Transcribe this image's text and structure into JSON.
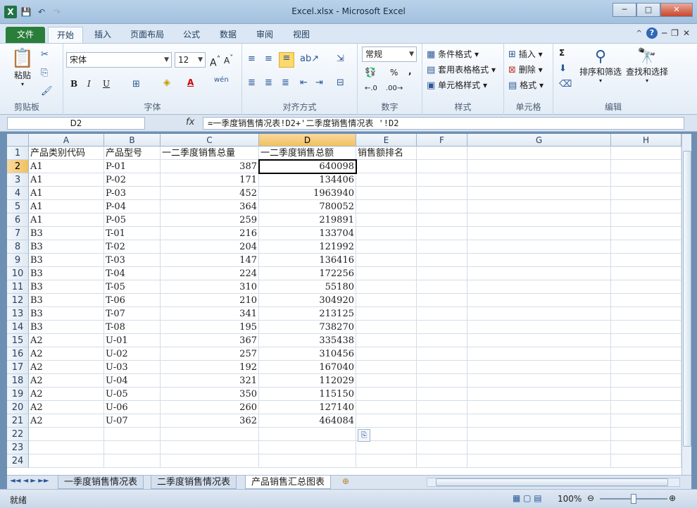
{
  "window": {
    "title": "Excel.xlsx - Microsoft Excel",
    "minimize": "─",
    "maximize": "□",
    "close": "✕"
  },
  "qat": {
    "logo": "X",
    "save": "💾",
    "undo": "↶",
    "redo": "↷"
  },
  "tabs": [
    {
      "label": "文件"
    },
    {
      "label": "开始"
    },
    {
      "label": "插入"
    },
    {
      "label": "页面布局"
    },
    {
      "label": "公式"
    },
    {
      "label": "数据"
    },
    {
      "label": "审阅"
    },
    {
      "label": "视图"
    }
  ],
  "ribbon": {
    "clipboard": {
      "name": "剪贴板",
      "paste": "粘贴"
    },
    "font": {
      "name": "字体",
      "font_name": "宋体",
      "font_size": "12",
      "bold": "B",
      "italic": "I",
      "underline": "U",
      "fontcolor": "A",
      "wen": "wén"
    },
    "alignment": {
      "name": "对齐方式"
    },
    "number": {
      "name": "数字",
      "format": "常规",
      "percent": "%",
      "comma": ","
    },
    "styles": {
      "name": "样式",
      "conditional": "条件格式",
      "table": "套用表格格式",
      "cell": "单元格样式"
    },
    "cells": {
      "name": "单元格",
      "insert": "插入",
      "delete": "删除",
      "format": "格式"
    },
    "editing": {
      "name": "编辑",
      "sort": "排序和筛选",
      "find": "查找和选择",
      "sigma": "Σ"
    }
  },
  "formula_bar": {
    "name_box": "D2",
    "fx": "fx",
    "formula": "=一季度销售情况表!D2+'二季度销售情况表 '!D2"
  },
  "columns": [
    "A",
    "B",
    "C",
    "D",
    "E",
    "F",
    "G",
    "H"
  ],
  "rows": [
    {
      "n": "1",
      "a": "产品类别代码",
      "b": "产品型号",
      "c": "一二季度销售总量",
      "d": "一二季度销售总额",
      "e": "销售额排名"
    },
    {
      "n": "2",
      "a": "A1",
      "b": "P-01",
      "c": "387",
      "d": "640098"
    },
    {
      "n": "3",
      "a": "A1",
      "b": "P-02",
      "c": "171",
      "d": "134406"
    },
    {
      "n": "4",
      "a": "A1",
      "b": "P-03",
      "c": "452",
      "d": "1963940"
    },
    {
      "n": "5",
      "a": "A1",
      "b": "P-04",
      "c": "364",
      "d": "780052"
    },
    {
      "n": "6",
      "a": "A1",
      "b": "P-05",
      "c": "259",
      "d": "219891"
    },
    {
      "n": "7",
      "a": "B3",
      "b": "T-01",
      "c": "216",
      "d": "133704"
    },
    {
      "n": "8",
      "a": "B3",
      "b": "T-02",
      "c": "204",
      "d": "121992"
    },
    {
      "n": "9",
      "a": "B3",
      "b": "T-03",
      "c": "147",
      "d": "136416"
    },
    {
      "n": "10",
      "a": "B3",
      "b": "T-04",
      "c": "224",
      "d": "172256"
    },
    {
      "n": "11",
      "a": "B3",
      "b": "T-05",
      "c": "310",
      "d": "55180"
    },
    {
      "n": "12",
      "a": "B3",
      "b": "T-06",
      "c": "210",
      "d": "304920"
    },
    {
      "n": "13",
      "a": "B3",
      "b": "T-07",
      "c": "341",
      "d": "213125"
    },
    {
      "n": "14",
      "a": "B3",
      "b": "T-08",
      "c": "195",
      "d": "738270"
    },
    {
      "n": "15",
      "a": "A2",
      "b": "U-01",
      "c": "367",
      "d": "335438"
    },
    {
      "n": "16",
      "a": "A2",
      "b": "U-02",
      "c": "257",
      "d": "310456"
    },
    {
      "n": "17",
      "a": "A2",
      "b": "U-03",
      "c": "192",
      "d": "167040"
    },
    {
      "n": "18",
      "a": "A2",
      "b": "U-04",
      "c": "321",
      "d": "112029"
    },
    {
      "n": "19",
      "a": "A2",
      "b": "U-05",
      "c": "350",
      "d": "115150"
    },
    {
      "n": "20",
      "a": "A2",
      "b": "U-06",
      "c": "260",
      "d": "127140"
    },
    {
      "n": "21",
      "a": "A2",
      "b": "U-07",
      "c": "362",
      "d": "464084"
    },
    {
      "n": "22"
    },
    {
      "n": "23"
    },
    {
      "n": "24"
    }
  ],
  "sheet_tabs": [
    "一季度销售情况表",
    "二季度销售情况表",
    "产品销售汇总图表"
  ],
  "status": {
    "ready": "就绪",
    "zoom": "100%"
  }
}
